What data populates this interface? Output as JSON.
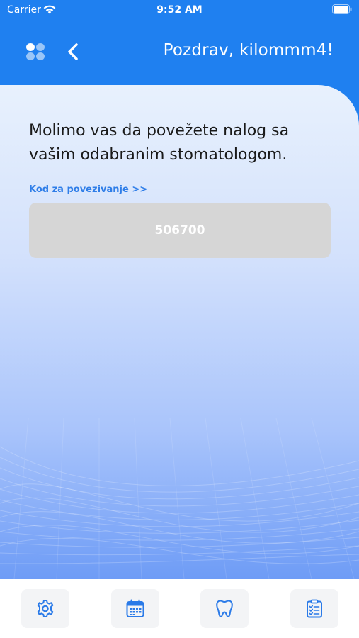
{
  "status_bar": {
    "carrier": "Carrier",
    "time": "9:52 AM"
  },
  "header": {
    "greeting": "Pozdrav, kilommm4!",
    "menu_icon": "grid-dots-icon",
    "back_icon": "chevron-left-icon",
    "color": "#1f80f0"
  },
  "content": {
    "message": "Molimo vas da povežete nalog sa vašim odabranim stomatologom.",
    "code_label": "Kod za povezivanje >>",
    "code_value": "506700"
  },
  "tabbar": {
    "items": [
      {
        "icon": "gear-icon"
      },
      {
        "icon": "calendar-icon"
      },
      {
        "icon": "tooth-icon"
      },
      {
        "icon": "clipboard-checklist-icon"
      }
    ],
    "icon_color": "#2a7ae8"
  }
}
